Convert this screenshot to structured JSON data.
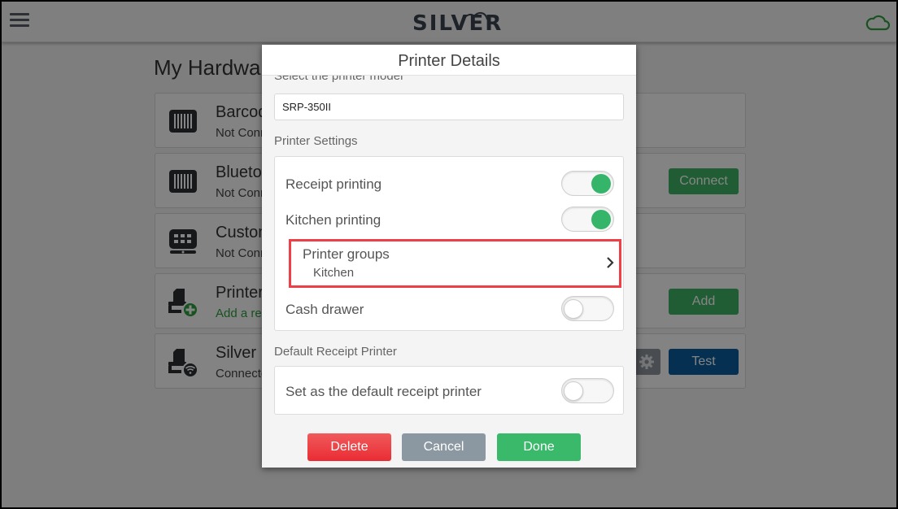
{
  "app": {
    "logo_text": "SILVER",
    "menu_icon": "hamburger-menu-icon",
    "sync_icon": "cloud-icon",
    "accent_color": "#2e9e3e"
  },
  "page": {
    "title": "My Hardware",
    "devices": [
      {
        "name": "Barcode Scanner",
        "status": "Not Connected",
        "icon": "barcode-icon",
        "action": null
      },
      {
        "name": "Bluetooth Scanner",
        "status": "Not Connected",
        "icon": "barcode-icon",
        "action": "Connect"
      },
      {
        "name": "Customer Display",
        "status": "Not Connected",
        "icon": "display-icon",
        "action": null
      },
      {
        "name": "Printer",
        "status": "Add a receipt printer",
        "icon": "printer-add-icon",
        "action": "Add"
      },
      {
        "name": "Silver receipt printer",
        "status": "Connected",
        "icon": "printer-wifi-icon",
        "action": "Test",
        "settings_icon": "gear-icon"
      }
    ]
  },
  "modal": {
    "title": "Printer Details",
    "model_label": "Select the printer model",
    "model_value": "SRP-350II",
    "settings_section": "Printer Settings",
    "settings": {
      "receipt_printing": {
        "label": "Receipt printing",
        "on": true
      },
      "kitchen_printing": {
        "label": "Kitchen printing",
        "on": true
      },
      "printer_groups": {
        "label": "Printer groups",
        "value": "Kitchen"
      },
      "cash_drawer": {
        "label": "Cash drawer",
        "on": false
      }
    },
    "default_section": "Default Receipt Printer",
    "default_setting": {
      "label": "Set as the default receipt printer",
      "on": false
    },
    "buttons": {
      "delete": "Delete",
      "cancel": "Cancel",
      "done": "Done"
    }
  }
}
